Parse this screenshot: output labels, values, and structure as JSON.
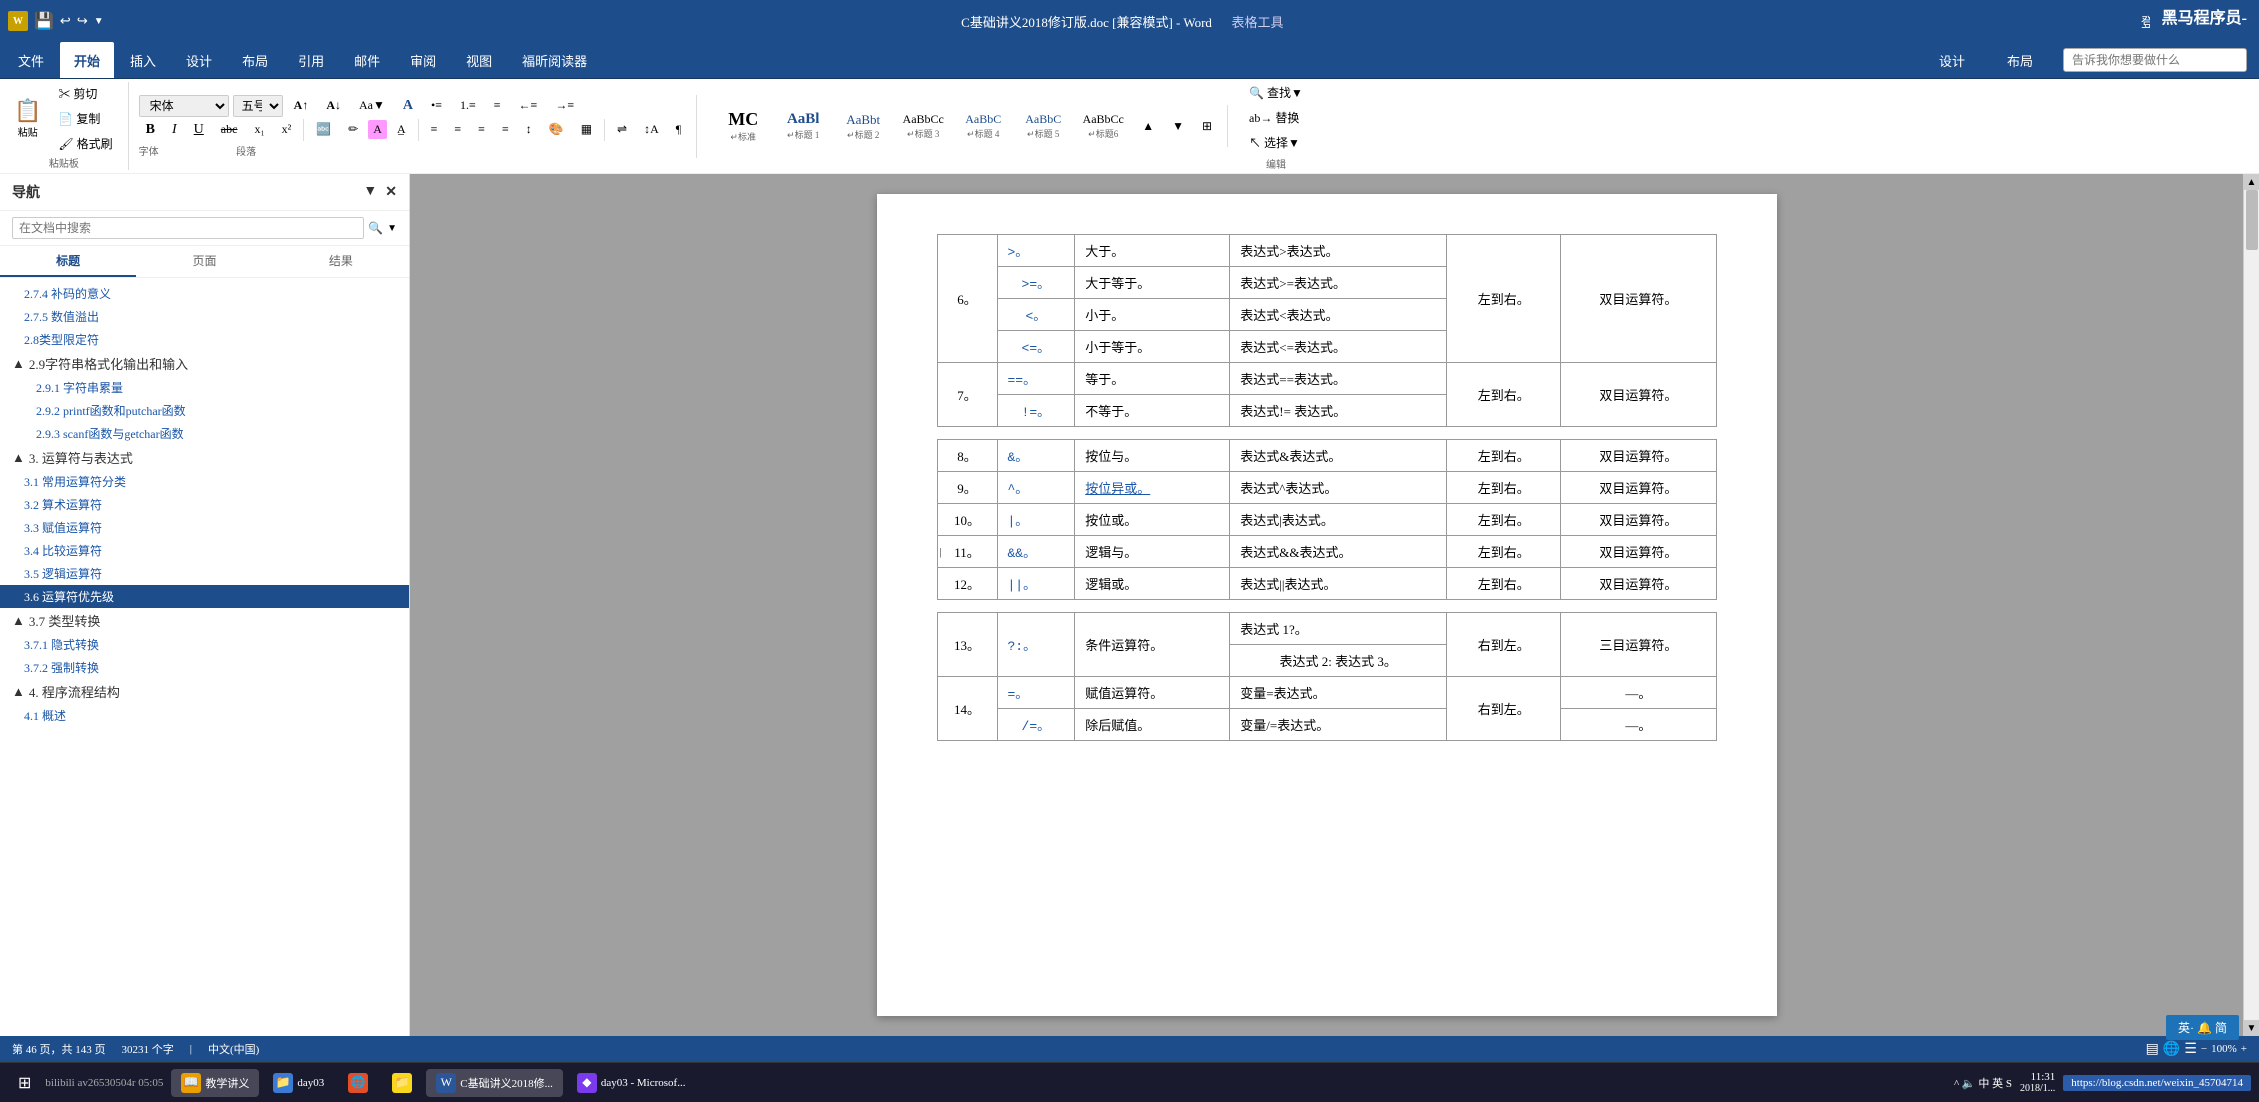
{
  "titlebar": {
    "filename": "C基础讲义2018修订版.doc [兼容模式] - Word",
    "tools_label": "表格工具",
    "login": "登录",
    "brand": "黑马程序员-",
    "min_btn": "—",
    "restore_btn": "□",
    "close_btn": "✕"
  },
  "ribbon": {
    "tabs": [
      "文件",
      "开始",
      "插入",
      "设计",
      "布局",
      "引用",
      "邮件",
      "审阅",
      "视图",
      "福昕阅读器"
    ],
    "active_tab": "开始",
    "table_tools_tabs": [
      "设计",
      "布局"
    ],
    "search_placeholder": "告诉我你想要做什么",
    "groups": {
      "clipboard": "粘贴板",
      "font": "字体",
      "paragraph": "段落",
      "styles": "样式",
      "editing": "编辑"
    }
  },
  "toolbar": {
    "paste_label": "粘贴",
    "cut_label": "剪切",
    "copy_label": "复制",
    "format_painter": "格式刷",
    "font_name": "宋体",
    "font_size": "五号",
    "bold": "B",
    "italic": "I",
    "underline": "U",
    "strikethrough": "abc",
    "subscript": "x₁",
    "superscript": "x²",
    "font_color": "A",
    "highlight": "✏",
    "align_left": "≡",
    "align_center": "≡",
    "align_right": "≡",
    "justify": "≡",
    "line_spacing": "↕",
    "indent_decrease": "←",
    "indent_increase": "→",
    "bullets": "•≡",
    "numbering": "1.≡",
    "sort": "↕",
    "show_marks": "¶"
  },
  "styles": {
    "items": [
      {
        "preview": "MC",
        "label": "↵标准"
      },
      {
        "preview": "AaBl",
        "label": "↵标题 1"
      },
      {
        "preview": "AaBbt",
        "label": "↵标题 2"
      },
      {
        "preview": "AaBbCc",
        "label": "↵标题 3"
      },
      {
        "preview": "AaBbC",
        "label": "↵标题 4"
      },
      {
        "preview": "AaBbC",
        "label": "↵标题 5"
      },
      {
        "preview": "AaBbCc",
        "label": "↵标题6"
      }
    ]
  },
  "editing": {
    "find": "查找",
    "replace": "替换",
    "select": "选择"
  },
  "navigation": {
    "title": "导航",
    "search_placeholder": "在文档中搜索",
    "tabs": [
      "标题",
      "页面",
      "结果"
    ],
    "active_tab": "标题",
    "items": [
      {
        "level": 2,
        "text": "2.7.4 补码的意义",
        "expanded": false
      },
      {
        "level": 2,
        "text": "2.7.5 数值溢出",
        "expanded": false
      },
      {
        "level": 2,
        "text": "2.8类型限定符",
        "expanded": false
      },
      {
        "level": 1,
        "text": "2.9字符串格式化输出和输入",
        "expanded": true,
        "triangle": "▲"
      },
      {
        "level": 2,
        "text": "2.9.1 字符串累量",
        "expanded": false
      },
      {
        "level": 2,
        "text": "2.9.2 printf函数和putchar函数",
        "expanded": false
      },
      {
        "level": 2,
        "text": "2.9.3 scanf函数与getchar函数",
        "expanded": false
      },
      {
        "level": 1,
        "text": "3. 运算符与表达式",
        "expanded": true,
        "triangle": "▲"
      },
      {
        "level": 2,
        "text": "3.1 常用运算符分类",
        "expanded": false
      },
      {
        "level": 2,
        "text": "3.2 算术运算符",
        "expanded": false
      },
      {
        "level": 2,
        "text": "3.3 赋值运算符",
        "expanded": false
      },
      {
        "level": 2,
        "text": "3.4 比较运算符",
        "expanded": false
      },
      {
        "level": 2,
        "text": "3.5 逻辑运算符",
        "expanded": false
      },
      {
        "level": 2,
        "text": "3.6 运算符优先级",
        "expanded": false,
        "active": true
      },
      {
        "level": 1,
        "text": "3.7 类型转换",
        "expanded": true,
        "triangle": "▲"
      },
      {
        "level": 2,
        "text": "3.7.1 隐式转换",
        "expanded": false
      },
      {
        "level": 2,
        "text": "3.7.2 强制转换",
        "expanded": false
      },
      {
        "level": 1,
        "text": "4. 程序流程结构",
        "expanded": true,
        "triangle": "▲"
      },
      {
        "level": 2,
        "text": "4.1 概述",
        "expanded": false
      }
    ]
  },
  "table": {
    "rows": [
      {
        "rownum": "",
        "operators": [
          {
            "op": ">",
            "name": "大于"
          },
          {
            "op": ">=",
            "name": "大于等于"
          },
          {
            "op": "<",
            "name": "小于"
          },
          {
            "op": "<=",
            "name": "小于等于"
          }
        ],
        "group_rownum": "6",
        "example_col": [
          "表达式>表达式",
          "表达式>=表达式",
          "表达式<表达式",
          "表达式<=表达式"
        ],
        "direction": "左到右",
        "type": "双目运算符"
      }
    ],
    "data": [
      {
        "num": "6",
        "ops": [
          {
            "op": ">。",
            "name": "大于。",
            "example": "表达式>表达式。"
          },
          {
            "op": ">=。",
            "name": "大于等于。",
            "example": "表达式>=表达式。"
          },
          {
            "op": "<。",
            "name": "小于。",
            "example": "表达式<表达式。"
          },
          {
            "op": "<=。",
            "name": "小于等于。",
            "example": "表达式<=表达式。"
          }
        ],
        "dir": "左到右。",
        "type": "双目运算符。"
      },
      {
        "num": "7",
        "ops": [
          {
            "op": "==。",
            "name": "等于。",
            "example": "表达式==表达式。"
          },
          {
            "op": "!=。",
            "name": "不等于。",
            "example": "表达式!= 表达式。"
          }
        ],
        "dir": "左到右。",
        "type": "双目运算符。"
      },
      {
        "num": "8",
        "ops": [
          {
            "op": "&。",
            "name": "按位与。",
            "example": "表达式&表达式。"
          }
        ],
        "dir": "左到右。",
        "type": "双目运算符。"
      },
      {
        "num": "9",
        "ops": [
          {
            "op": "^。",
            "name": "按位异或。",
            "example": "表达式^表达式。"
          }
        ],
        "dir": "左到右。",
        "type": "双目运算符。"
      },
      {
        "num": "10",
        "ops": [
          {
            "op": "|。",
            "name": "按位或。",
            "example": "表达式|表达式。"
          }
        ],
        "dir": "左到右。",
        "type": "双目运算符。"
      },
      {
        "num": "11",
        "ops": [
          {
            "op": "&&。",
            "name": "逻辑与。",
            "example": "表达式&&表达式。"
          }
        ],
        "dir": "左到右。",
        "type": "双目运算符。"
      },
      {
        "num": "12",
        "ops": [
          {
            "op": "||。",
            "name": "逻辑或。",
            "example": "表达式||表达式。"
          }
        ],
        "dir": "左到右。",
        "type": "双目运算符。"
      },
      {
        "num": "13",
        "ops": [
          {
            "op": "?:。",
            "name": "条件运算符。",
            "example1": "表达式 1?。",
            "example2": "表达式 2: 表达式 3。"
          }
        ],
        "dir": "右到左。",
        "type": "三目运算符。"
      },
      {
        "num": "14",
        "ops": [
          {
            "op": "=。",
            "name": "赋值运算符。",
            "example": "变量=表达式。"
          },
          {
            "op": "/=。",
            "name": "除后赋值。",
            "example": "变量/=表达式。"
          }
        ],
        "dir": "右到左。",
        "type": "—。"
      }
    ]
  },
  "statusbar": {
    "page_info": "第 46 页，共 143 页",
    "word_count": "30231 个字",
    "lang": "中文(中国)"
  },
  "taskbar": {
    "start": "⊞",
    "bilibili": "bilibili av26530504r 0505",
    "apps": [
      {
        "icon": "📖",
        "label": "教学讲义"
      },
      {
        "icon": "📁",
        "label": "day03"
      },
      {
        "icon": "🌐",
        "label": ""
      },
      {
        "icon": "📁",
        "label": ""
      },
      {
        "icon": "W",
        "label": "C基础讲义2018修..."
      },
      {
        "icon": "◆",
        "label": "day03 - Microsof..."
      }
    ],
    "time": "11:31",
    "date": "2018/1..."
  }
}
